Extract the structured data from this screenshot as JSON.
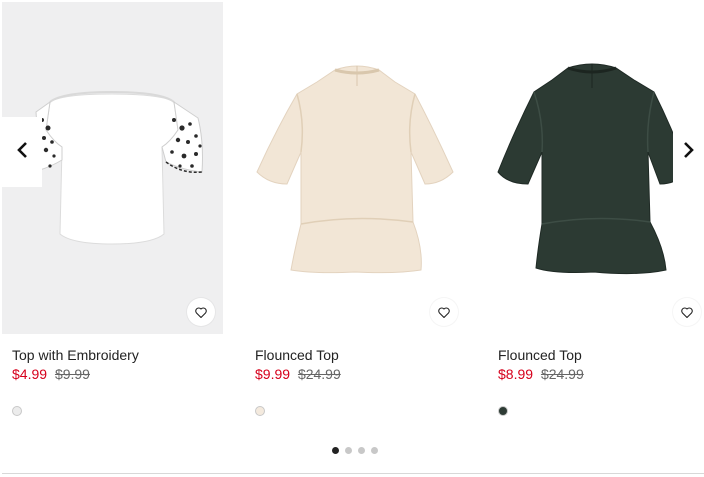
{
  "carousel": {
    "prev_icon": "chevron-left-icon",
    "next_icon": "chevron-right-icon",
    "page_count": 4,
    "active_page": 1
  },
  "products": [
    {
      "title": "Top with Embroidery",
      "sale_price": "$4.99",
      "old_price": "$9.99",
      "swatch_color": "#ececec",
      "image_bg": "#efeff0",
      "garment_color": "#ffffff",
      "wishlist_icon": "heart-icon"
    },
    {
      "title": "Flounced Top",
      "sale_price": "$9.99",
      "old_price": "$24.99",
      "swatch_color": "#f4eade",
      "image_bg": "#ffffff",
      "garment_color": "#f2e6d6",
      "wishlist_icon": "heart-icon"
    },
    {
      "title": "Flounced Top",
      "sale_price": "$8.99",
      "old_price": "$24.99",
      "swatch_color": "#2d3b34",
      "image_bg": "#ffffff",
      "garment_color": "#2c3a33",
      "wishlist_icon": "heart-icon"
    }
  ]
}
